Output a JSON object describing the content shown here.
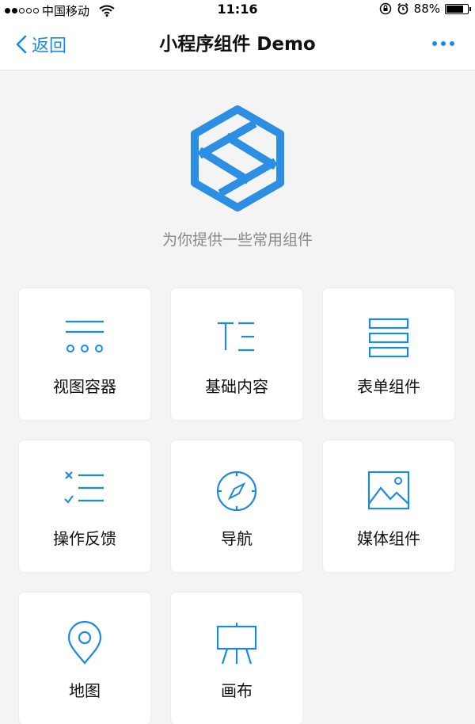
{
  "status_bar": {
    "carrier": "中国移动",
    "time": "11:16",
    "battery": "88%",
    "battery_level": 0.88
  },
  "nav": {
    "back_label": "返回",
    "title": "小程序组件 Demo"
  },
  "intro": {
    "subtitle": "为你提供一些常用组件"
  },
  "components": [
    {
      "label": "视图容器",
      "icon": "view-container-icon"
    },
    {
      "label": "基础内容",
      "icon": "text-content-icon"
    },
    {
      "label": "表单组件",
      "icon": "form-icon"
    },
    {
      "label": "操作反馈",
      "icon": "feedback-list-icon"
    },
    {
      "label": "导航",
      "icon": "compass-icon"
    },
    {
      "label": "媒体组件",
      "icon": "image-icon"
    },
    {
      "label": "地图",
      "icon": "map-pin-icon"
    },
    {
      "label": "画布",
      "icon": "easel-icon"
    }
  ],
  "colors": {
    "accent": "#1b8ae6",
    "background": "#f4f4f4",
    "subtitle": "#888888"
  }
}
